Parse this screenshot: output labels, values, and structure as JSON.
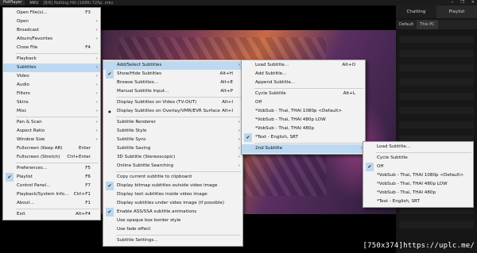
{
  "titlebar": {
    "app": "PotPlayer",
    "format": "MKV",
    "title": "[8/6] Notting Hill (1999).720p .mkv",
    "controls": [
      "⎯",
      "❐",
      "✕"
    ]
  },
  "sidepanel": {
    "tabs": [
      "Chatting",
      "Playlist"
    ],
    "bar": [
      "Default",
      "This PC"
    ]
  },
  "watermark": "[750x374]https://uplc.me/",
  "menus": {
    "main": {
      "groups": [
        [
          {
            "label": "Open File(s)...",
            "shortcut": "F3",
            "arrow": false,
            "checked": false
          },
          {
            "label": "Open",
            "shortcut": "",
            "arrow": true,
            "checked": false
          },
          {
            "label": "Broadcast",
            "shortcut": "",
            "arrow": true,
            "checked": false
          },
          {
            "label": "Album/Favorites",
            "shortcut": "",
            "arrow": true,
            "checked": false
          },
          {
            "label": "Close File",
            "shortcut": "F4",
            "arrow": false,
            "checked": false
          }
        ],
        [
          {
            "label": "Playback",
            "shortcut": "",
            "arrow": true,
            "checked": false
          },
          {
            "label": "Subtitles",
            "shortcut": "",
            "arrow": true,
            "checked": false,
            "active": true
          },
          {
            "label": "Video",
            "shortcut": "",
            "arrow": true,
            "checked": false
          },
          {
            "label": "Audio",
            "shortcut": "",
            "arrow": true,
            "checked": false
          },
          {
            "label": "Filters",
            "shortcut": "",
            "arrow": true,
            "checked": false
          },
          {
            "label": "Skins",
            "shortcut": "",
            "arrow": true,
            "checked": false
          },
          {
            "label": "Misc",
            "shortcut": "",
            "arrow": true,
            "checked": false
          }
        ],
        [
          {
            "label": "Pan & Scan",
            "shortcut": "",
            "arrow": true,
            "checked": false
          },
          {
            "label": "Aspect Ratio",
            "shortcut": "",
            "arrow": true,
            "checked": false
          },
          {
            "label": "Window Size",
            "shortcut": "",
            "arrow": true,
            "checked": false
          },
          {
            "label": "Fullscreen (Keep AR)",
            "shortcut": "Enter",
            "arrow": false,
            "checked": false
          },
          {
            "label": "Fullscreen (Stretch)",
            "shortcut": "Ctrl+Enter",
            "arrow": false,
            "checked": false
          }
        ],
        [
          {
            "label": "Preferences...",
            "shortcut": "F5",
            "arrow": false,
            "checked": false
          },
          {
            "label": "Playlist",
            "shortcut": "F6",
            "arrow": false,
            "checked": true
          },
          {
            "label": "Control Panel...",
            "shortcut": "F7",
            "arrow": false,
            "checked": false
          },
          {
            "label": "Playback/System Info...",
            "shortcut": "Ctrl+F1",
            "arrow": false,
            "checked": false
          },
          {
            "label": "About...",
            "shortcut": "F1",
            "arrow": false,
            "checked": false
          }
        ],
        [
          {
            "label": "Exit",
            "shortcut": "Alt+F4",
            "arrow": false,
            "checked": false
          }
        ]
      ]
    },
    "subtitles": {
      "groups": [
        [
          {
            "label": "Add/Select Subtitles",
            "shortcut": "",
            "arrow": true,
            "checked": false,
            "active": true
          },
          {
            "label": "Show/Hide Subtitles",
            "shortcut": "Alt+H",
            "arrow": false,
            "checked": true
          },
          {
            "label": "Browse Subtitles...",
            "shortcut": "Alt+E",
            "arrow": false,
            "checked": false
          },
          {
            "label": "Manual Subtitle Input...",
            "shortcut": "Alt+P",
            "arrow": false,
            "checked": false
          }
        ],
        [
          {
            "label": "Display Subtitles on Video (TV-OUT)",
            "shortcut": "Alt+I",
            "arrow": false,
            "checked": false
          },
          {
            "label": "Display Subtitles on Overlay/VMR/EVR Surface",
            "shortcut": "Alt+I",
            "arrow": false,
            "checked": false,
            "bullet": true
          }
        ],
        [
          {
            "label": "Subtitle Renderer",
            "shortcut": "",
            "arrow": true,
            "checked": false
          },
          {
            "label": "Subtitle Style",
            "shortcut": "",
            "arrow": true,
            "checked": false
          },
          {
            "label": "Subtitle Sync",
            "shortcut": "",
            "arrow": true,
            "checked": false
          },
          {
            "label": "Subtitle Saving",
            "shortcut": "",
            "arrow": true,
            "checked": false
          },
          {
            "label": "3D Subtitle (Stereoscopic)",
            "shortcut": "",
            "arrow": true,
            "checked": false
          },
          {
            "label": "Online Subtitle Searching",
            "shortcut": "",
            "arrow": true,
            "checked": false
          }
        ],
        [
          {
            "label": "Copy current subtitle to clipboard",
            "shortcut": "",
            "arrow": false,
            "checked": false
          },
          {
            "label": "Display bitmap subtitles outside video image",
            "shortcut": "",
            "arrow": false,
            "checked": true
          },
          {
            "label": "Display text subtitles inside video image",
            "shortcut": "",
            "arrow": false,
            "checked": false
          },
          {
            "label": "Display subtitles under video image (if possible)",
            "shortcut": "",
            "arrow": false,
            "checked": false
          },
          {
            "label": "Enable ASS/SSA subtitle animations",
            "shortcut": "",
            "arrow": false,
            "checked": true
          },
          {
            "label": "Use opaque box border style",
            "shortcut": "",
            "arrow": false,
            "checked": false
          },
          {
            "label": "Use fade effect",
            "shortcut": "",
            "arrow": false,
            "checked": false
          }
        ],
        [
          {
            "label": "Subtitle Settings...",
            "shortcut": "",
            "arrow": false,
            "checked": false
          }
        ]
      ]
    },
    "add_select": {
      "groups": [
        [
          {
            "label": "Load Subtitle...",
            "shortcut": "Alt+O",
            "arrow": false,
            "checked": false
          },
          {
            "label": "Add Subtitle...",
            "shortcut": "",
            "arrow": false,
            "checked": false
          },
          {
            "label": "Append Subtitle...",
            "shortcut": "",
            "arrow": false,
            "checked": false
          }
        ],
        [
          {
            "label": "Cycle Subtitle",
            "shortcut": "Alt+L",
            "arrow": false,
            "checked": false
          },
          {
            "label": "Off",
            "shortcut": "",
            "arrow": false,
            "checked": false
          },
          {
            "label": "*VobSub - Thai, THAI 1080p <Default>",
            "shortcut": "",
            "arrow": false,
            "checked": false
          },
          {
            "label": "*VobSub - Thai, THAI 480p LOW",
            "shortcut": "",
            "arrow": false,
            "checked": false
          },
          {
            "label": "*VobSub - Thai, THAI 480p",
            "shortcut": "",
            "arrow": false,
            "checked": false
          },
          {
            "label": "*Text - English, SRT",
            "shortcut": "",
            "arrow": false,
            "checked": true
          }
        ],
        [
          {
            "label": "2nd Subtitle",
            "shortcut": "",
            "arrow": true,
            "checked": false,
            "active": true
          }
        ]
      ]
    },
    "second_subtitle": {
      "groups": [
        [
          {
            "label": "Load Subtitle...",
            "shortcut": "",
            "arrow": false,
            "checked": false
          }
        ],
        [
          {
            "label": "Cycle Subtitle",
            "shortcut": "",
            "arrow": false,
            "checked": false
          },
          {
            "label": "Off",
            "shortcut": "",
            "arrow": false,
            "checked": true
          },
          {
            "label": "*VobSub - Thai, THAI 1080p <Default>",
            "shortcut": "",
            "arrow": false,
            "checked": false
          },
          {
            "label": "*VobSub - Thai, THAI 480p LOW",
            "shortcut": "",
            "arrow": false,
            "checked": false
          },
          {
            "label": "*VobSub - Thai, THAI 480p",
            "shortcut": "",
            "arrow": false,
            "checked": false
          },
          {
            "label": "*Text - English, SRT",
            "shortcut": "",
            "arrow": false,
            "checked": false
          }
        ]
      ]
    }
  }
}
